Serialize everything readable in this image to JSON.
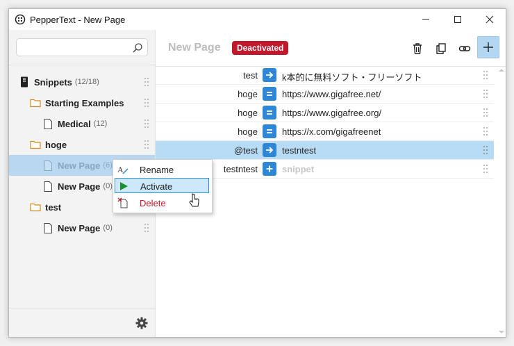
{
  "window": {
    "title": "PepperText - New Page"
  },
  "sidebar": {
    "search": {
      "value": "",
      "placeholder": ""
    },
    "tree": [
      {
        "label": "Snippets",
        "count": "(12/18)",
        "icon": "database-icon"
      },
      {
        "label": "Starting Examples",
        "count": "",
        "icon": "folder-icon"
      },
      {
        "label": "Medical",
        "count": "(12)",
        "icon": "page-icon"
      },
      {
        "label": "hoge",
        "count": "",
        "icon": "folder-icon"
      },
      {
        "label": "New Page",
        "count": "(6)",
        "icon": "page-icon",
        "selected": true
      },
      {
        "label": "New Page",
        "count": "(0)",
        "icon": "page-icon"
      },
      {
        "label": "test",
        "count": "",
        "icon": "folder-icon"
      },
      {
        "label": "New Page",
        "count": "(0)",
        "icon": "page-icon"
      }
    ]
  },
  "main": {
    "page_title": "New Page",
    "status_badge": "Deactivated",
    "snippets": [
      {
        "key": "test",
        "op": "arrow",
        "value": "k本的に無料ソフト・フリーソフト"
      },
      {
        "key": "hoge",
        "op": "equals",
        "value": "https://www.gigafree.net/"
      },
      {
        "key": "hoge",
        "op": "equals",
        "value": "https://www.gigafree.org/"
      },
      {
        "key": "hoge",
        "op": "equals",
        "value": "https://x.com/gigafreenet"
      },
      {
        "key": "@test",
        "op": "arrow",
        "value": "testntest",
        "selected": true
      },
      {
        "key": "testntest",
        "op": "plus",
        "value": "snippet",
        "placeholder": true
      }
    ]
  },
  "context_menu": {
    "items": [
      {
        "label": "Rename",
        "icon": "rename-icon"
      },
      {
        "label": "Activate",
        "icon": "play-icon",
        "highlighted": true
      },
      {
        "label": "Delete",
        "icon": "delete-icon"
      }
    ]
  },
  "colors": {
    "accent": "#2e86d4",
    "danger": "#c2182b",
    "selection": "#b9dcf6"
  }
}
